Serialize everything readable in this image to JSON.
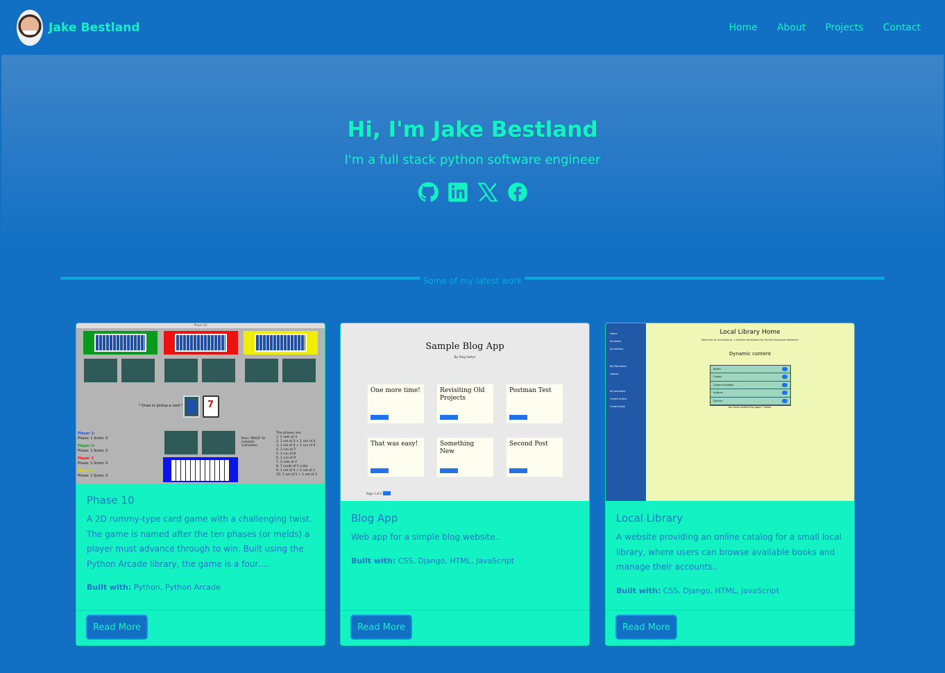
{
  "brand": {
    "name": "Jake Bestland"
  },
  "nav": {
    "items": [
      "Home",
      "About",
      "Projects",
      "Contact"
    ]
  },
  "hero": {
    "title": "Hi, I'm Jake Bestland",
    "subtitle": "I'm a full stack python software engineer",
    "socials": [
      "github-icon",
      "linkedin-icon",
      "x-icon",
      "facebook-icon"
    ]
  },
  "divider": {
    "label": "Some of my latest work"
  },
  "projects": [
    {
      "title": "Phase 10",
      "description": "A 2D rummy-type card game with a challenging twist. The game is named after the ten phases (or melds) a player must advance through to win. Built using the Python Arcade library, the game is a four….",
      "built_label": "Built with:",
      "built_with": "Python, Python Arcade",
      "button": "Read More",
      "thumbnail": {
        "window_title": "Phase 10",
        "prompt": "* Draw or pickup a card *",
        "players": [
          "Player 1:",
          "Player 2:",
          "Player 3",
          "Player 4"
        ],
        "player_stats": "Phase: 1    Score: 0",
        "help": "Press \"SPACE\" for complete instructions",
        "phases_title": "The phases are:",
        "phases": [
          "1. 2 sets of 3",
          "2. 1 set of 3 + 1 run of 4",
          "3. 1 set of 4 + 1 run of 4",
          "4. 1 run of 7",
          "5. 1 run of 8",
          "6. 1 run of 9",
          "7. 2 sets of 4",
          "8. 7 cards of 1 color",
          "9. 1 set of 5 + 1 set of 2",
          "10. 1 set of 5 + 1 set of 3"
        ]
      }
    },
    {
      "title": "Blog App",
      "description": "Web app for a simple blog website..",
      "built_label": "Built with:",
      "built_with": "CSS, Django, HTML, JavaScript",
      "button": "Read More",
      "thumbnail": {
        "title": "Sample Blog App",
        "by": "By: Blog Author",
        "posts": [
          "One more time!",
          "Revisiting Old Projects",
          "Postman Test",
          "That was easy!",
          "Something New",
          "Second Post"
        ],
        "pager": "Page 1 of 2"
      }
    },
    {
      "title": "Local Library",
      "description": "A website providing an online catalog for a small local library, where users can browse available books and manage their accounts..",
      "built_label": "Built with:",
      "built_with": "CSS, Django, HTML, JavaScript",
      "button": "Read More",
      "thumbnail": {
        "title": "Local Library Home",
        "welcome": "Welcome to LocalLibrary, a website developed by Mozilla Developer Network!",
        "section": "Dynamic content",
        "rows": [
          "Books",
          "Copies",
          "Copies available",
          "Authors",
          "Genres"
        ],
        "footer": "You have visited this page 7 times.",
        "sidebar": [
          "Home",
          "All books",
          "All authors",
          "My Borrowed",
          "Logout",
          "All borrowed",
          "Create author",
          "Create book"
        ]
      }
    }
  ],
  "colors": {
    "background": "#116fc4",
    "accent": "#13f2c3",
    "text_on_card": "#1e78c6"
  }
}
